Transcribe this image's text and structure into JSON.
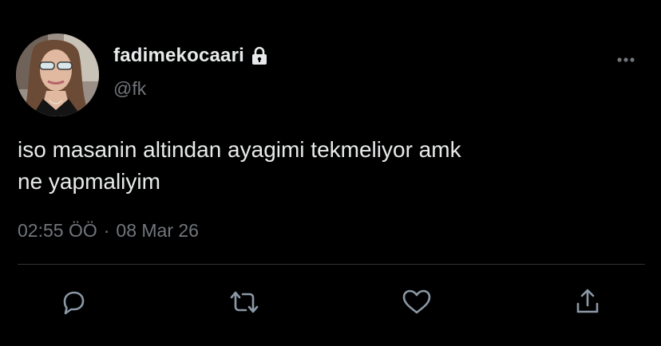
{
  "tweet": {
    "display_name": "fadimekocaari",
    "handle": "@fk",
    "text": "iso masanin altindan ayagimi tekmeliyor amk\nne yapmaliyim",
    "time": "02:55 ÖÖ",
    "separator": "·",
    "date": "08 Mar 26",
    "protected_icon": "lock-icon",
    "more_icon": "more-horizontal-icon"
  },
  "actions": [
    {
      "name": "reply",
      "icon": "reply-icon"
    },
    {
      "name": "retweet",
      "icon": "retweet-icon"
    },
    {
      "name": "like",
      "icon": "heart-icon"
    },
    {
      "name": "share",
      "icon": "share-icon"
    }
  ],
  "colors": {
    "background": "#000000",
    "primary_text": "#e7e9ea",
    "secondary_text": "#71767b",
    "divider": "#2f3336"
  }
}
